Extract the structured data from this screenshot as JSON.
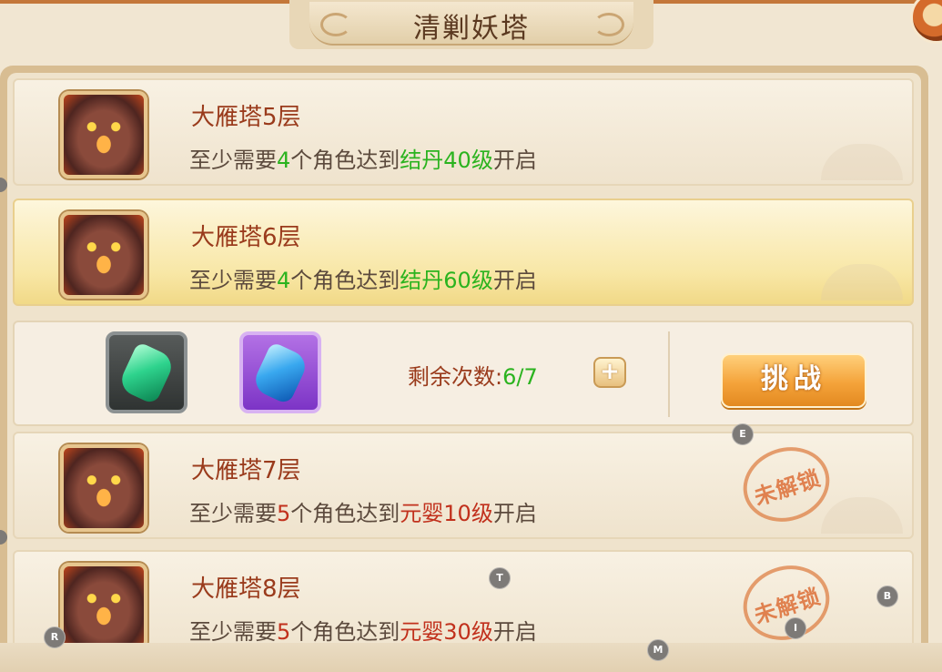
{
  "window": {
    "title": "清剿妖塔"
  },
  "floors": [
    {
      "name": "大雁塔5层",
      "req_prefix": "至少需要",
      "count": "4",
      "req_mid": "个角色达到",
      "level": "结丹40级",
      "req_suffix": "开启",
      "locked": false,
      "selected": false
    },
    {
      "name": "大雁塔6层",
      "req_prefix": "至少需要",
      "count": "4",
      "req_mid": "个角色达到",
      "level": "结丹60级",
      "req_suffix": "开启",
      "locked": false,
      "selected": true
    },
    {
      "name": "大雁塔7层",
      "req_prefix": "至少需要",
      "count": "5",
      "req_mid": "个角色达到",
      "level": "元婴10级",
      "req_suffix": "开启",
      "locked": true,
      "selected": false
    },
    {
      "name": "大雁塔8层",
      "req_prefix": "至少需要",
      "count": "5",
      "req_mid": "个角色达到",
      "level": "元婴30级",
      "req_suffix": "开启",
      "locked": true,
      "selected": false
    }
  ],
  "stamp_text": "未解锁",
  "action_bar": {
    "remaining_label": "剩余次数:",
    "remaining_value": "6/7",
    "plus_label": "+",
    "challenge_label": "挑战",
    "items": [
      "green-gem-icon",
      "blue-gem-icon"
    ]
  },
  "markers": [
    "E",
    "T",
    "B",
    "R",
    "I",
    "M"
  ],
  "colors": {
    "title": "#5b3920",
    "name": "#9a3b1c",
    "ok": "#2bb31f",
    "locked": "#c1301c",
    "button": "#f4a33a"
  }
}
